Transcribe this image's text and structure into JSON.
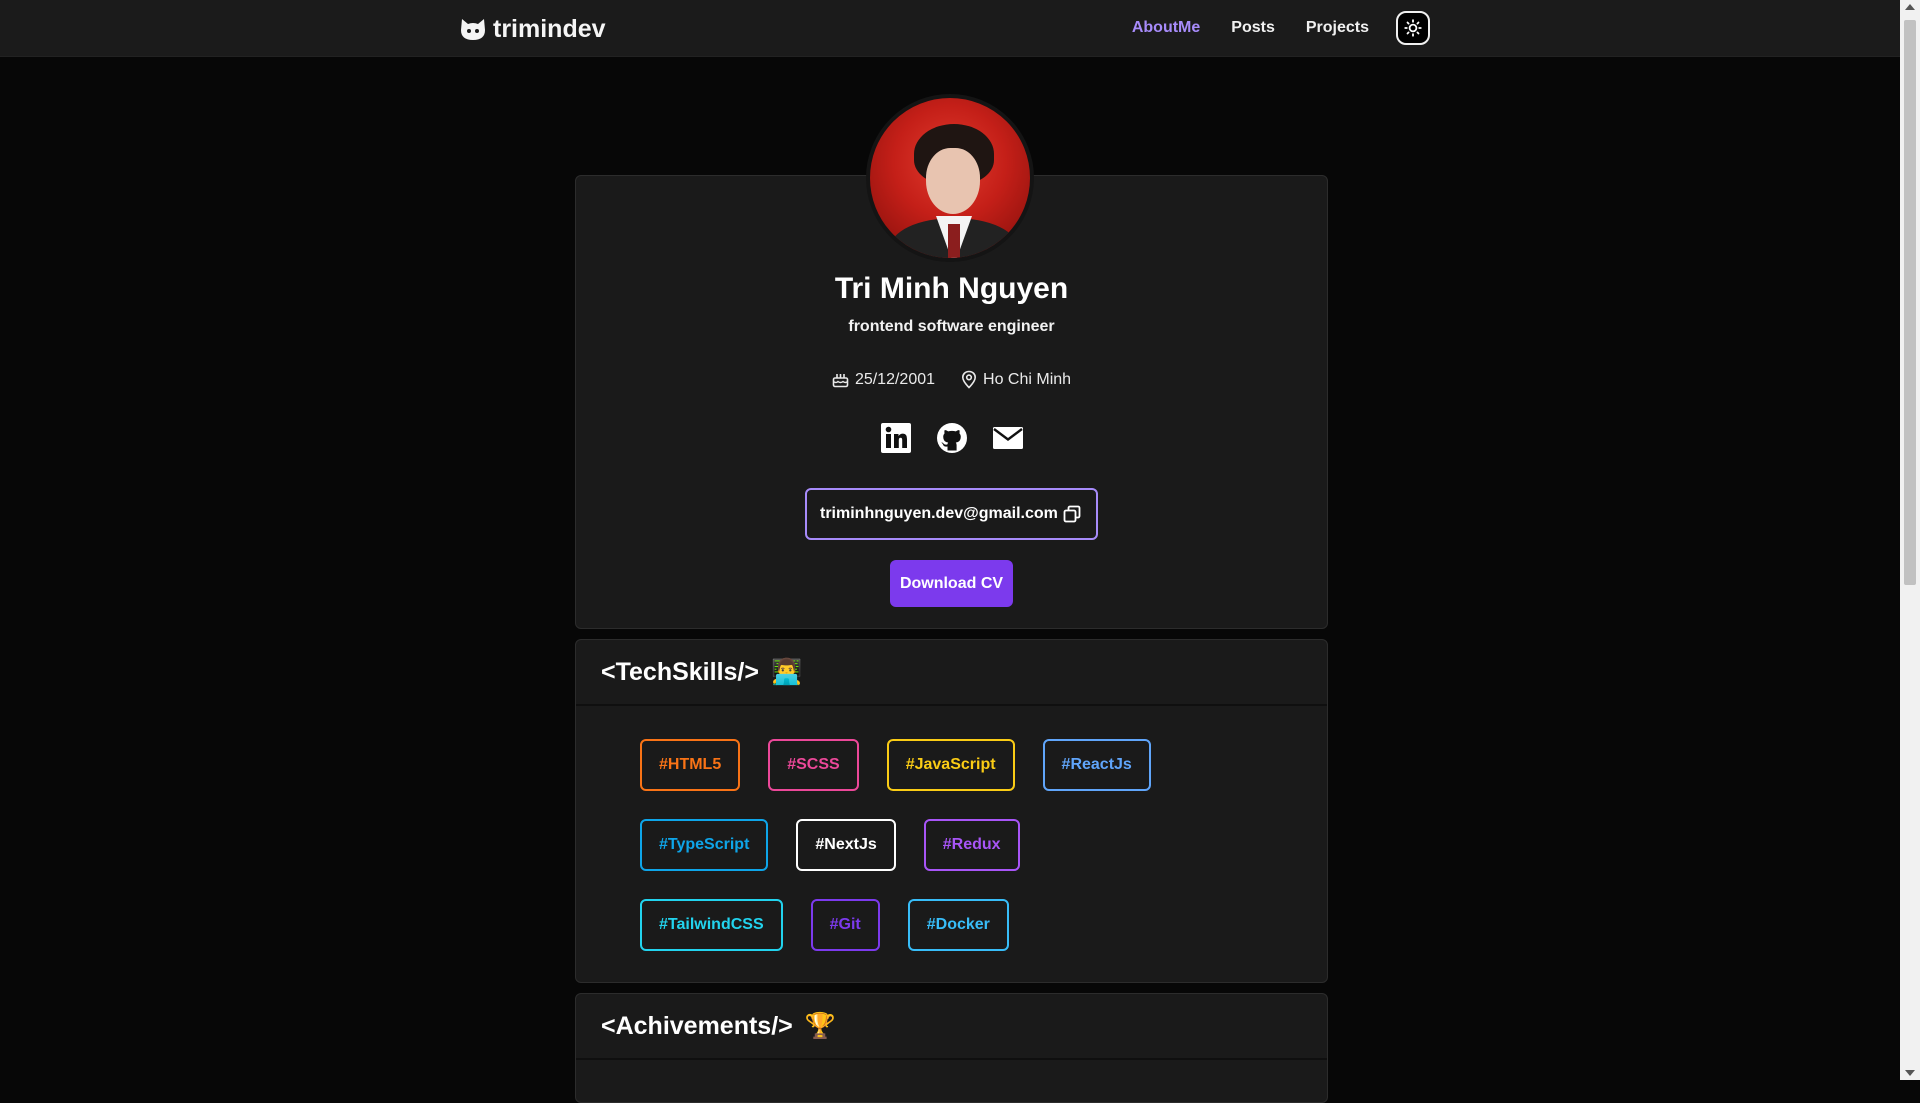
{
  "header": {
    "brand": "trimindev",
    "nav": [
      {
        "label": "AboutMe",
        "active": true
      },
      {
        "label": "Posts",
        "active": false
      },
      {
        "label": "Projects",
        "active": false
      }
    ],
    "theme_icon": "sun-icon"
  },
  "profile": {
    "name": "Tri Minh Nguyen",
    "role": "frontend software engineer",
    "birthday": "25/12/2001",
    "location": "Ho Chi Minh",
    "socials": [
      "linkedin-icon",
      "github-icon",
      "mail-icon"
    ],
    "email": "triminhnguyen.dev@gmail.com",
    "download_label": "Download CV"
  },
  "tech_skills": {
    "title": "<TechSkills/>",
    "emoji": "👨‍💻",
    "rows": [
      [
        {
          "label": "#HTML5",
          "color": "#f97316"
        },
        {
          "label": "#SCSS",
          "color": "#ec4899"
        },
        {
          "label": "#JavaScript",
          "color": "#facc15"
        },
        {
          "label": "#ReactJs",
          "color": "#60a5fa"
        }
      ],
      [
        {
          "label": "#TypeScript",
          "color": "#0ea5e9"
        },
        {
          "label": "#NextJs",
          "color": "#ffffff"
        },
        {
          "label": "#Redux",
          "color": "#a855f7"
        }
      ],
      [
        {
          "label": "#TailwindCSS",
          "color": "#22d3ee"
        },
        {
          "label": "#Git",
          "color": "#7c3aed"
        },
        {
          "label": "#Docker",
          "color": "#38bdf8"
        }
      ]
    ]
  },
  "achievements": {
    "title": "<Achivements/>",
    "emoji": "🏆"
  },
  "colors": {
    "accent": "#7c3aed",
    "accent_light": "#a78bfa",
    "background": "#070707",
    "card": "#1a1a1a"
  }
}
